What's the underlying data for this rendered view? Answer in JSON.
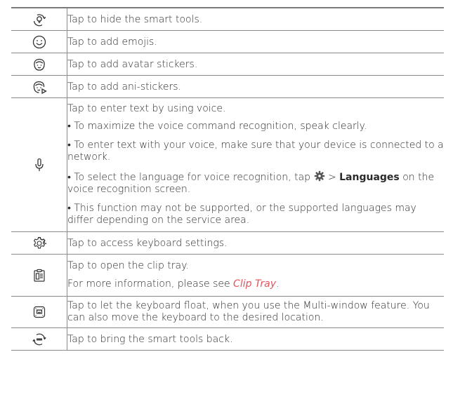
{
  "rows": {
    "hide_tools": "Tap to hide the smart tools.",
    "emojis": "Tap to add emojis.",
    "avatar_stickers": "Tap to add avatar stickers.",
    "ani_stickers": "Tap to add ani-stickers.",
    "voice": {
      "intro": "Tap to enter text by using voice.",
      "bullet1": "• To maximize the voice command recognition, speak clearly.",
      "bullet2": "• To enter text with your voice, make sure that your device is connected to a network.",
      "bullet3_pre": "• To select the language for voice recognition, tap",
      "bullet3_arrow": ">",
      "bullet3_bold": "Languages",
      "bullet3_post": "on the voice recognition screen.",
      "bullet4": "• This function may not be supported, or the supported languages may differ depending on the service area."
    },
    "settings": "Tap to access keyboard settings.",
    "clip": {
      "line1": "Tap to open the clip tray.",
      "line2_pre": "For more information, please see",
      "line2_link": "Clip Tray",
      "line2_post": "."
    },
    "float": "Tap to let the keyboard float, when you use the Multi-window feature. You can also move the keyboard to the desired location.",
    "bring_back": "Tap to bring the smart tools back."
  },
  "icons": {
    "hide_tools": "hide-smart-tools-icon",
    "emojis": "emoji-icon",
    "avatar": "avatar-sticker-icon",
    "ani": "ani-sticker-icon",
    "voice": "microphone-icon",
    "settings": "gear-icon",
    "clip": "clip-tray-icon",
    "float": "floating-keyboard-icon",
    "bring_back": "show-smart-tools-icon"
  },
  "colors": {
    "link": "#e2525b",
    "text": "#2b2b2b",
    "rule": "#8a8a8a"
  }
}
